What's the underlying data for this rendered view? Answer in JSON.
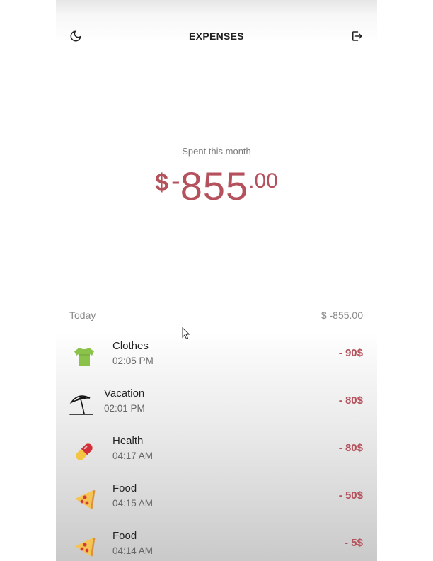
{
  "header": {
    "title": "EXPENSES",
    "left_icon": "moon-icon",
    "right_icon": "logout-icon"
  },
  "summary": {
    "label": "Spent this month",
    "currency": "$",
    "sign": "-",
    "integer": "855",
    "decimal": ".00"
  },
  "day_group": {
    "label": "Today",
    "total": "$ -855.00"
  },
  "expenses": [
    {
      "name": "Clothes",
      "time": "02:05 PM",
      "amount": "- 90$",
      "icon": "tshirt-icon"
    },
    {
      "name": "Vacation",
      "time": "02:01 PM",
      "amount": "- 80$",
      "icon": "beach-umbrella-icon"
    },
    {
      "name": "Health",
      "time": "04:17 AM",
      "amount": "- 80$",
      "icon": "pill-icon"
    },
    {
      "name": "Food",
      "time": "04:15 AM",
      "amount": "- 50$",
      "icon": "pizza-icon"
    },
    {
      "name": "Food",
      "time": "04:14 AM",
      "amount": "- 5$",
      "icon": "pizza-icon"
    }
  ],
  "colors": {
    "accent": "#b5515c",
    "text": "#222222",
    "muted": "#8a8a8a"
  }
}
